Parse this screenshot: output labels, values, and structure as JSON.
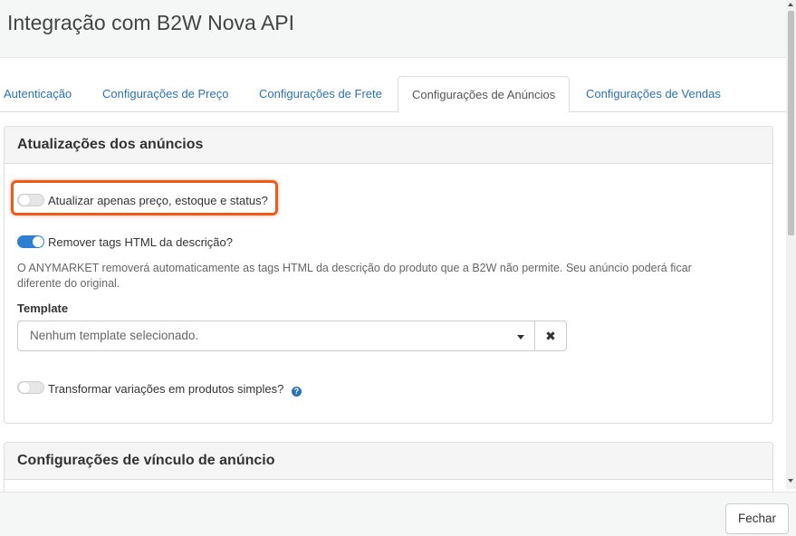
{
  "modal": {
    "title": "Integração com B2W Nova API"
  },
  "tabs": [
    {
      "label": "Autenticação",
      "active": false
    },
    {
      "label": "Configurações de Preço",
      "active": false
    },
    {
      "label": "Configurações de Frete",
      "active": false
    },
    {
      "label": "Configurações de Anúncios",
      "active": true
    },
    {
      "label": "Configurações de Vendas",
      "active": false
    }
  ],
  "ad_updates": {
    "title": "Atualizações dos anúncios",
    "update_only_price_stock_status": {
      "label": "Atualizar apenas preço, estoque e status?",
      "enabled": false
    },
    "remove_html_tags": {
      "label": "Remover tags HTML da descrição?",
      "enabled": true
    },
    "help_text": "O ANYMARKET removerá automaticamente as tags HTML da descrição do produto que a B2W não permite. Seu anúncio poderá ficar diferente do original.",
    "template": {
      "label": "Template",
      "value": "Nenhum template selecionado.",
      "clear_icon": "times-icon"
    },
    "transform_variations": {
      "label": "Transformar variações em produtos simples?",
      "enabled": false,
      "help_icon": "question-circle-icon"
    }
  },
  "ad_link_settings": {
    "title": "Configurações de vínculo de anúncio"
  },
  "footer": {
    "close_label": "Fechar"
  },
  "colors": {
    "accent": "#2a72b8",
    "toggle_on": "#2e7fd1",
    "highlight": "#ec5a1c"
  }
}
